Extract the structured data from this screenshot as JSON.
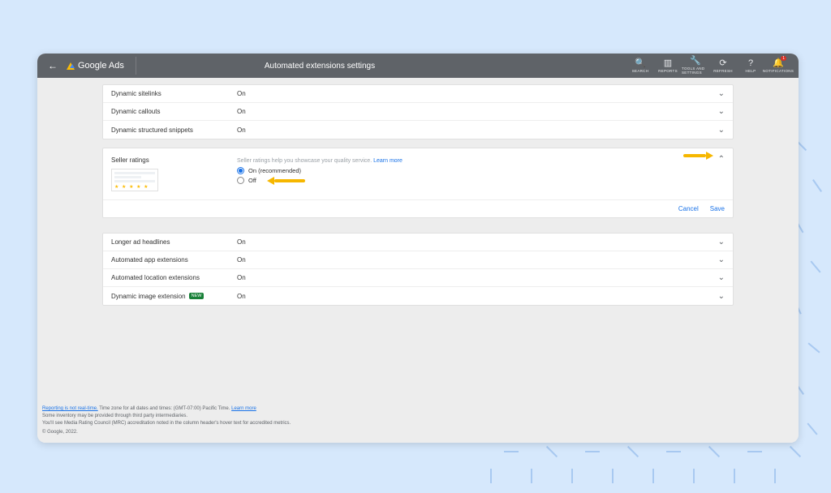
{
  "header": {
    "brand": "Google Ads",
    "page_title": "Automated extensions settings",
    "tools": [
      {
        "icon": "🔍",
        "label": "SEARCH"
      },
      {
        "icon": "▥",
        "label": "REPORTS"
      },
      {
        "icon": "🔧",
        "label": "TOOLS AND SETTINGS"
      },
      {
        "icon": "⟳",
        "label": "REFRESH"
      },
      {
        "icon": "?",
        "label": "HELP"
      },
      {
        "icon": "🔔",
        "label": "NOTIFICATIONS",
        "badge": "1"
      }
    ]
  },
  "panel1": {
    "rows": [
      {
        "name": "Dynamic sitelinks",
        "status": "On"
      },
      {
        "name": "Dynamic callouts",
        "status": "On"
      },
      {
        "name": "Dynamic structured snippets",
        "status": "On"
      }
    ]
  },
  "seller_ratings": {
    "name": "Seller ratings",
    "help_text": "Seller ratings help you showcase your quality service.",
    "learn_more": "Learn more",
    "options": {
      "on": "On (recommended)",
      "off": "Off"
    },
    "actions": {
      "cancel": "Cancel",
      "save": "Save"
    }
  },
  "panel2": {
    "rows": [
      {
        "name": "Longer ad headlines",
        "status": "On"
      },
      {
        "name": "Automated app extensions",
        "status": "On"
      },
      {
        "name": "Automated location extensions",
        "status": "On"
      },
      {
        "name": "Dynamic image extension",
        "status": "On",
        "new": "NEW"
      }
    ]
  },
  "footer": {
    "line1_link": "Reporting is not real-time.",
    "line1_rest": " Time zone for all dates and times: (GMT-07:00) Pacific Time. ",
    "line1_learn": "Learn more",
    "line2": "Some inventory may be provided through third party intermediaries.",
    "line3": "You'll see Media Rating Council (MRC) accreditation noted in the column header's hover text for accredited metrics.",
    "copyright": "© Google, 2022."
  }
}
